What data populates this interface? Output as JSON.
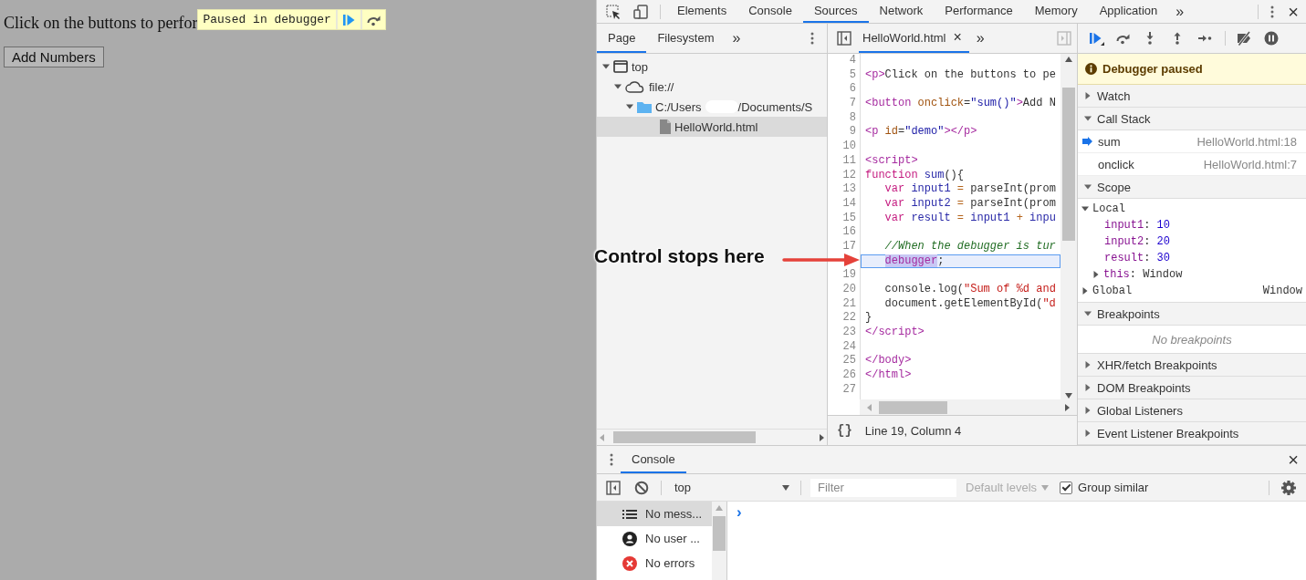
{
  "page": {
    "text": "Click on the buttons to perfor",
    "button": "Add Numbers",
    "paused_overlay": {
      "label": "Paused in debugger",
      "buttons": [
        {
          "kind": "resume"
        },
        {
          "kind": "step-over"
        }
      ]
    }
  },
  "devtools": {
    "tabs": [
      {
        "label": "Elements",
        "selected": false
      },
      {
        "label": "Console",
        "selected": false
      },
      {
        "label": "Sources",
        "selected": true
      },
      {
        "label": "Network",
        "selected": false
      },
      {
        "label": "Performance",
        "selected": false
      },
      {
        "label": "Memory",
        "selected": false
      },
      {
        "label": "Application",
        "selected": false
      }
    ],
    "more": "»",
    "close": "×",
    "navigator": {
      "tabs": [
        {
          "label": "Page",
          "selected": true
        },
        {
          "label": "Filesystem",
          "selected": false
        }
      ],
      "more": "»",
      "tree": [
        {
          "kind": "frame",
          "label": "top",
          "expanded": true,
          "selected": false,
          "children": [
            {
              "kind": "origin",
              "label": "file://",
              "expanded": true,
              "selected": false,
              "children": [
                {
                  "kind": "folder",
                  "label": "C:/Users",
                  "label_end": "/Documents/S",
                  "expanded": true,
                  "selected": false,
                  "children": [
                    {
                      "kind": "file",
                      "label": "HelloWorld.html",
                      "selected": true
                    }
                  ]
                }
              ]
            }
          ]
        }
      ]
    },
    "editor": {
      "tabs": [
        {
          "label": "HelloWorld.html",
          "close": "×",
          "selected": true
        }
      ],
      "more": "»",
      "lines": [
        {
          "number": "4",
          "current": false
        },
        {
          "number": "5",
          "current": false,
          "indented": false,
          "tokens": [
            {
              "text": "<p>",
              "kind": "tag"
            },
            {
              "text": "Click on the buttons to pe",
              "kind": "plain"
            }
          ]
        },
        {
          "number": "6",
          "current": false
        },
        {
          "number": "7",
          "current": false,
          "indented": false,
          "tokens": [
            {
              "text": "<button",
              "kind": "tag"
            },
            {
              "text": " onclick",
              "kind": "attr"
            },
            {
              "text": "=",
              "kind": "plain"
            },
            {
              "text": "\"sum()\"",
              "kind": "str"
            },
            {
              "text": ">",
              "kind": "tag"
            },
            {
              "text": "Add N",
              "kind": "plain"
            }
          ]
        },
        {
          "number": "8",
          "current": false
        },
        {
          "number": "9",
          "current": false,
          "indented": false,
          "tokens": [
            {
              "text": "<p",
              "kind": "tag"
            },
            {
              "text": " id",
              "kind": "attr"
            },
            {
              "text": "=",
              "kind": "plain"
            },
            {
              "text": "\"demo\"",
              "kind": "str"
            },
            {
              "text": "></p>",
              "kind": "tag"
            }
          ]
        },
        {
          "number": "10",
          "current": false
        },
        {
          "number": "11",
          "current": false,
          "indented": false,
          "tokens": [
            {
              "text": "<script>",
              "kind": "tag"
            }
          ]
        },
        {
          "number": "12",
          "current": false,
          "indented": false,
          "tokens": [
            {
              "text": "function ",
              "kind": "kw"
            },
            {
              "text": "sum",
              "kind": "def"
            },
            {
              "text": "(){",
              "kind": "plain"
            }
          ]
        },
        {
          "number": "13",
          "current": false,
          "indented": true,
          "tokens": [
            {
              "text": "var ",
              "kind": "kw"
            },
            {
              "text": "input1",
              "kind": "def"
            },
            {
              "text": " = ",
              "kind": "op"
            },
            {
              "text": "parseInt(prom",
              "kind": "plain"
            }
          ]
        },
        {
          "number": "14",
          "current": false,
          "indented": true,
          "tokens": [
            {
              "text": "var ",
              "kind": "kw"
            },
            {
              "text": "input2",
              "kind": "def"
            },
            {
              "text": " = ",
              "kind": "op"
            },
            {
              "text": "parseInt(prom",
              "kind": "plain"
            }
          ]
        },
        {
          "number": "15",
          "current": false,
          "indented": true,
          "tokens": [
            {
              "text": "var ",
              "kind": "kw"
            },
            {
              "text": "result",
              "kind": "def"
            },
            {
              "text": " = ",
              "kind": "op"
            },
            {
              "text": "input1",
              "kind": "def"
            },
            {
              "text": " + ",
              "kind": "op"
            },
            {
              "text": "inpu",
              "kind": "def"
            }
          ]
        },
        {
          "number": "16",
          "current": false
        },
        {
          "number": "17",
          "current": false,
          "indented": true,
          "tokens": [
            {
              "text": "//When the debugger is tur",
              "kind": "comment"
            }
          ]
        },
        {
          "current": true,
          "indented": true,
          "tokens": [
            {
              "text": "debugger",
              "kind": "match"
            },
            {
              "text": ";",
              "kind": "plain"
            }
          ]
        },
        {
          "number": "19",
          "current": false
        },
        {
          "number": "20",
          "current": false,
          "indented": true,
          "tokens": [
            {
              "text": "console.log(",
              "kind": "plain"
            },
            {
              "text": "\"Sum of %d and",
              "kind": "jsstr"
            }
          ]
        },
        {
          "number": "21",
          "current": false,
          "indented": true,
          "tokens": [
            {
              "text": "document.getElementById(",
              "kind": "plain"
            },
            {
              "text": "\"d",
              "kind": "jsstr"
            }
          ]
        },
        {
          "number": "22",
          "current": false,
          "indented": false,
          "tokens": [
            {
              "text": "}",
              "kind": "plain"
            }
          ]
        },
        {
          "number": "23",
          "current": false,
          "indented": false,
          "tokens": [
            {
              "text": "</script>",
              "kind": "tag"
            }
          ]
        },
        {
          "number": "24",
          "current": false
        },
        {
          "number": "25",
          "current": false,
          "indented": false,
          "tokens": [
            {
              "text": "</body>",
              "kind": "tag"
            }
          ]
        },
        {
          "number": "26",
          "current": false,
          "indented": false,
          "tokens": [
            {
              "text": "</html>",
              "kind": "tag"
            }
          ]
        },
        {
          "number": "27",
          "current": false
        }
      ],
      "status": {
        "pretty_print": "{}",
        "position": "Line 19, Column 4"
      }
    },
    "debugger": {
      "toolbar": [
        {
          "kind": "resume",
          "active": true
        },
        {
          "kind": "step-over",
          "active": false
        },
        {
          "kind": "step-into",
          "active": false
        },
        {
          "kind": "step-out",
          "active": false
        },
        {
          "kind": "step",
          "active": false
        },
        {
          "kind": "deactivate",
          "active": false
        },
        {
          "kind": "pause-exceptions",
          "active": false
        }
      ],
      "banner": "Debugger paused",
      "sections": [
        {
          "title": "Watch",
          "expanded": false
        },
        {
          "title": "Call Stack",
          "expanded": true,
          "kind": "frames",
          "frames": [
            {
              "name": "sum",
              "location": "HelloWorld.html:18",
              "selected": true
            },
            {
              "name": "onclick",
              "location": "HelloWorld.html:7",
              "selected": false
            }
          ]
        },
        {
          "title": "Scope",
          "expanded": true,
          "kind": "scope",
          "scopes": [
            {
              "name": "Local",
              "expanded": true,
              "vars": [
                {
                  "kind": "number",
                  "name": "input1",
                  "colon": ":",
                  "value": "10"
                },
                {
                  "kind": "number",
                  "name": "input2",
                  "colon": ":",
                  "value": "20"
                },
                {
                  "kind": "number",
                  "name": "result",
                  "colon": ":",
                  "value": "30"
                },
                {
                  "kind": "object",
                  "name": "this",
                  "colon": ":",
                  "value": "Window",
                  "expanded": false
                }
              ]
            },
            {
              "name": "Global",
              "value": "Window",
              "expanded": false
            }
          ]
        },
        {
          "title": "Breakpoints",
          "expanded": true,
          "kind": "empty",
          "message": "No breakpoints"
        },
        {
          "title": "XHR/fetch Breakpoints",
          "expanded": false
        },
        {
          "title": "DOM Breakpoints",
          "expanded": false
        },
        {
          "title": "Global Listeners",
          "expanded": false
        },
        {
          "title": "Event Listener Breakpoints",
          "expanded": false
        }
      ]
    },
    "drawer": {
      "tabs": [
        {
          "label": "Console",
          "selected": true
        }
      ],
      "close": "×",
      "toolbar": {
        "context": "top",
        "filter_placeholder": "Filter",
        "levels": {
          "label": "Default levels",
          "disabled": true
        },
        "group_similar": {
          "label": "Group similar",
          "checked": true
        }
      },
      "sidebar": [
        {
          "kind": "messages",
          "label": "No mess...",
          "selected": true
        },
        {
          "kind": "user",
          "label": "No user ...",
          "selected": false
        },
        {
          "kind": "errors",
          "label": "No errors",
          "selected": false
        }
      ],
      "prompt": "›"
    }
  },
  "annotation": {
    "label": "Control stops here"
  }
}
